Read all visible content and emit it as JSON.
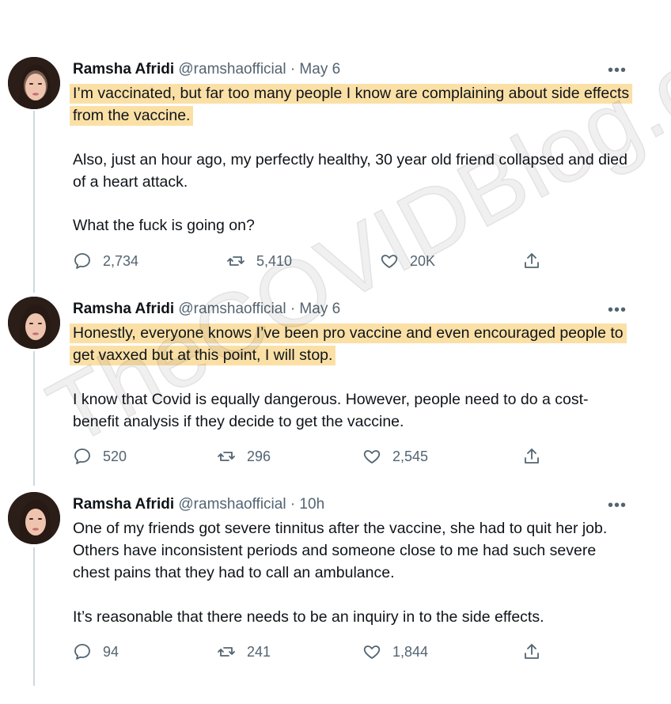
{
  "watermark": "TheCOVIDBlog.com",
  "tweets": [
    {
      "name": "Ramsha Afridi",
      "handle": "@ramshaofficial",
      "time": "· May 6",
      "highlight": "I’m vaccinated, but far too many people I know are complaining about side effects from the vaccine.",
      "paragraphs": [
        "Also, just an hour ago, my perfectly healthy, 30 year old friend collapsed and died of a heart attack.",
        "What the fuck is going on?"
      ],
      "replies": "2,734",
      "retweets": "5,410",
      "likes": "20K"
    },
    {
      "name": "Ramsha Afridi",
      "handle": "@ramshaofficial",
      "time": "· May 6",
      "highlight": "Honestly, everyone knows I’ve been pro vaccine and even encouraged people to get vaxxed but at this point, I will stop.",
      "paragraphs": [
        "I know that Covid is equally dangerous. However, people need to do a cost-benefit analysis if they decide to get the vaccine."
      ],
      "replies": "520",
      "retweets": "296",
      "likes": "2,545"
    },
    {
      "name": "Ramsha Afridi",
      "handle": "@ramshaofficial",
      "time": "· 10h",
      "paragraphs": [
        "One of my friends got severe tinnitus after the vaccine, she had to quit her job. Others have inconsistent periods and someone close to me had such severe chest pains that they had to call an ambulance.",
        "It’s reasonable that there needs to be an inquiry in to the side effects."
      ],
      "replies": "94",
      "retweets": "241",
      "likes": "1,844"
    }
  ],
  "colors": {
    "highlight": "#f7c75d",
    "secondary_text": "#536471",
    "thread_line": "#cfd9de"
  }
}
